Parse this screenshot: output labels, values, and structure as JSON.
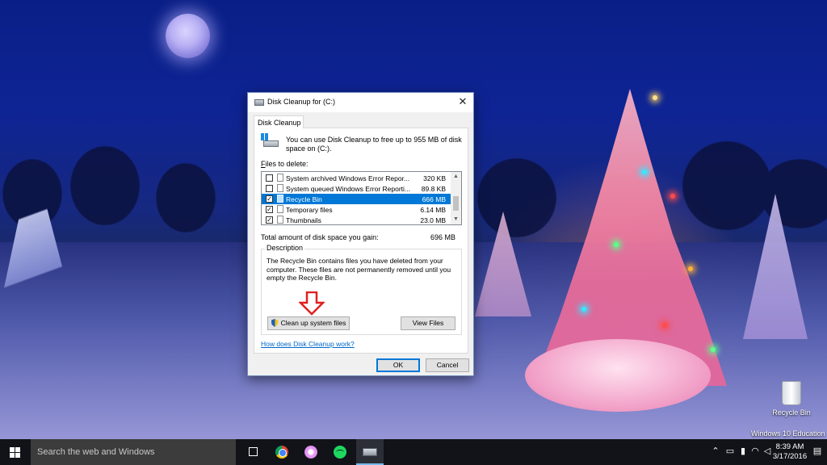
{
  "dialog": {
    "title": "Disk Cleanup for  (C:)",
    "close_glyph": "✕",
    "tab_label": "Disk Cleanup",
    "intro": "You can use Disk Cleanup to free up to 955 MB of disk space on  (C:).",
    "files_label_prefix": "F",
    "files_label_rest": "iles to delete:",
    "files": [
      {
        "name": "System archived Windows Error Repor...",
        "size": "320 KB",
        "checked": false,
        "selected": false
      },
      {
        "name": "System queued Windows Error Reporti...",
        "size": "89.8 KB",
        "checked": false,
        "selected": false
      },
      {
        "name": "Recycle Bin",
        "size": "666 MB",
        "checked": true,
        "selected": true
      },
      {
        "name": "Temporary files",
        "size": "6.14 MB",
        "checked": true,
        "selected": false
      },
      {
        "name": "Thumbnails",
        "size": "23.0 MB",
        "checked": true,
        "selected": false
      }
    ],
    "total_label": "Total amount of disk space you gain:",
    "total_value": "696 MB",
    "description_legend": "Description",
    "description_text": "The Recycle Bin contains files you have deleted from your computer. These files are not permanently removed until you empty the Recycle Bin.",
    "cleanup_system_button": "Clean up system files",
    "view_files_button": "View Files",
    "help_link": "How does Disk Cleanup work?",
    "ok_button": "OK",
    "cancel_button": "Cancel"
  },
  "desktop": {
    "recycle_bin_label": "Recycle Bin",
    "watermark": "Windows 10 Education"
  },
  "taskbar": {
    "search_placeholder": "Search the web and Windows",
    "pinned": [
      "task-view-icon",
      "chrome-icon",
      "itunes-icon",
      "spotify-icon",
      "disk-cleanup-icon"
    ],
    "tray_icons": [
      "chevron-up-icon",
      "tablet-mode-icon",
      "battery-icon",
      "wifi-icon",
      "volume-icon",
      "action-center-icon"
    ],
    "time": "8:39 AM",
    "date": "3/17/2016"
  },
  "colors": {
    "selection": "#0078d7",
    "link": "#0066cc",
    "annotation_arrow": "#e02020",
    "taskbar": "#111318"
  }
}
